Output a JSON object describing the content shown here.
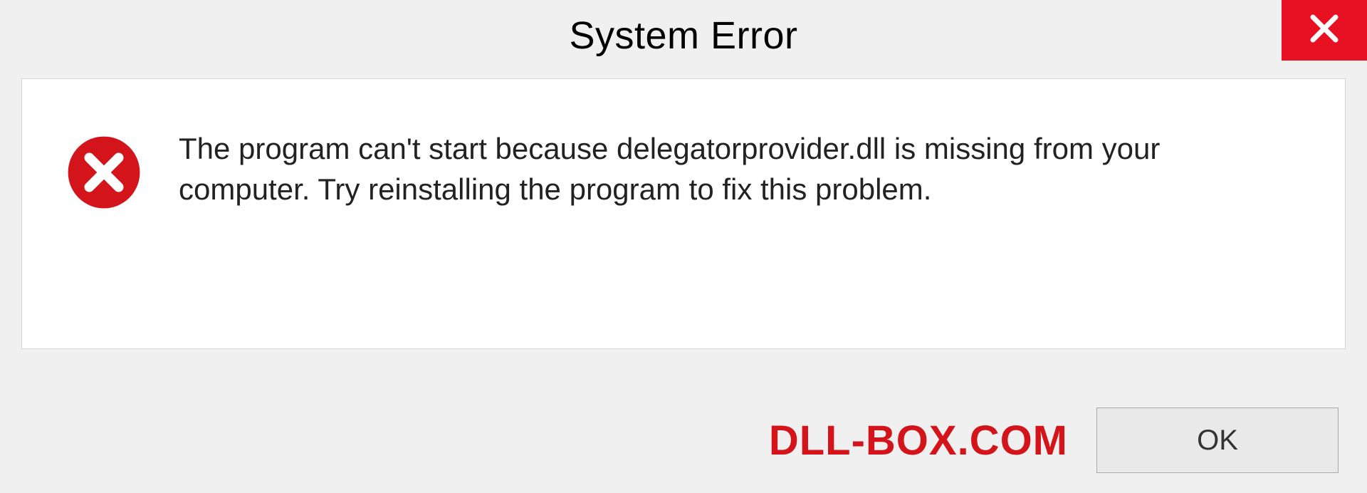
{
  "dialog": {
    "title": "System Error",
    "message": "The program can't start because delegatorprovider.dll is missing from your computer. Try reinstalling the program to fix this problem.",
    "ok_label": "OK"
  },
  "watermark": "DLL-BOX.COM",
  "colors": {
    "close_bg": "#e81123",
    "error_red": "#d4141b"
  }
}
